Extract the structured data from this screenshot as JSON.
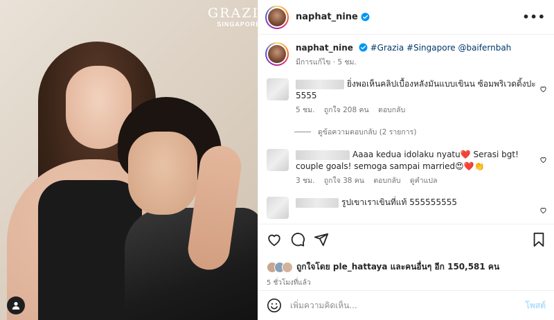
{
  "brand": {
    "line1": "GRAZIA",
    "line2": "SINGAPORE"
  },
  "post": {
    "username": "naphat_nine",
    "caption_user": "naphat_nine",
    "caption_tags": "#Grazia #Singapore @baifernbah",
    "caption_meta": "มีการแก้ไข · 5 ชม.",
    "likes_text": "ถูกใจโดย ple_hattaya และคนอื่นๆ อีก 150,581 คน",
    "time": "5 ชั่วโมงที่แล้ว"
  },
  "comments": [
    {
      "text": "ยิ่งพอเห็นคลิปเบื้องหลังมันแบบเขินน ซ้อมพริเวดดิ้งปะ 5555",
      "time": "5 ชม.",
      "likes": "ถูกใจ 208 คน",
      "reply": "ตอบกลับ",
      "view_replies": "ดูข้อความตอบกลับ (2 รายการ)"
    },
    {
      "text": "Aaaa kedua idolaku nyatu❤️ Serasi bgt! couple goals! semoga sampai married😍❤️👏",
      "time": "3 ชม.",
      "likes": "ถูกใจ 38 คน",
      "reply": "ตอบกลับ",
      "translate": "ดูคำแปล"
    },
    {
      "text": "รูปเขาเราเขินที่แท้ 555555555"
    }
  ],
  "add_comment": {
    "placeholder": "เพิ่มความคิดเห็น...",
    "post_label": "โพสต์"
  },
  "icons": {
    "more": "more-icon",
    "like": "heart-icon",
    "comment": "comment-icon",
    "share": "share-icon",
    "save": "bookmark-icon",
    "emoji": "emoji-icon",
    "verified": "verified-icon",
    "user_tag": "user-tag-icon"
  },
  "colors": {
    "verified": "#0095f6",
    "tag": "#00376b",
    "post_disabled": "#b2dffc",
    "muted": "#737373"
  }
}
